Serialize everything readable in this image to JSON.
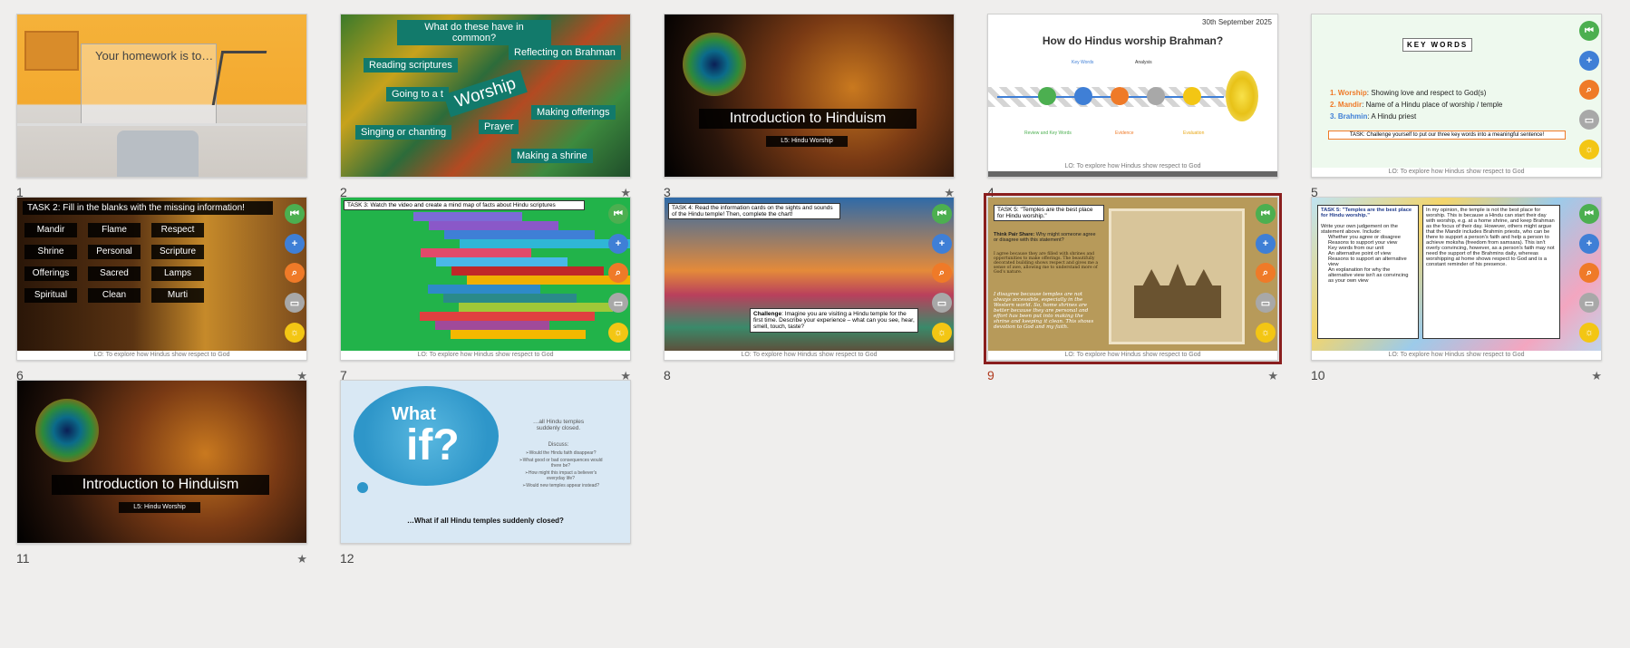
{
  "slides": [
    {
      "num": "1",
      "title": "Your homework is to…"
    },
    {
      "num": "2",
      "title": "What do these have in common?",
      "star": "★",
      "tags": [
        "Reflecting on Brahman",
        "Reading scriptures",
        "Going to a t",
        "Worship",
        "Making offerings",
        "Prayer",
        "Singing or chanting",
        "Making a shrine"
      ]
    },
    {
      "num": "3",
      "star": "★",
      "title": "Introduction to Hinduism",
      "subtitle": "L5: Hindu Worship"
    },
    {
      "num": "4",
      "date": "30th September 2025",
      "title": "How do Hindus worship Brahman?",
      "labels": [
        "Key Words",
        "Analysis",
        "Review and Key Words",
        "Evidence",
        "Evaluation"
      ],
      "lo": "LO: To explore how Hindus show respect to God"
    },
    {
      "num": "5",
      "keywords_title": "KEY WORDS",
      "items": [
        {
          "n": "1.",
          "term": "Worship",
          "def": ": Showing love and respect to God(s)"
        },
        {
          "n": "2.",
          "term": "Mandir",
          "def": ": Name of a Hindu place of worship / temple"
        },
        {
          "n": "3.",
          "term": "Brahmin",
          "def": ": A Hindu priest"
        }
      ],
      "task": "TASK: Challenge yourself to put our three key words into a meaningful sentence!",
      "lo": "LO: To explore how Hindus show respect to God"
    },
    {
      "num": "6",
      "star": "★",
      "title": "TASK 2: Fill in the blanks with the missing information!",
      "words": [
        "Mandir",
        "Flame",
        "Respect",
        "Shrine",
        "Personal",
        "Scripture",
        "Offerings",
        "Sacred",
        "Lamps",
        "Spiritual",
        "Clean",
        "Murti"
      ],
      "lo": "LO: To explore how Hindus show respect to God"
    },
    {
      "num": "7",
      "star": "★",
      "title": "TASK 3: Watch the video and create a mind map of facts about Hindu scriptures",
      "lo": "LO: To explore how Hindus show respect to God"
    },
    {
      "num": "8",
      "title": "TASK 4: Read the information cards on the sights and sounds of the Hindu temple! Then, complete the chart!",
      "challenge_label": "Challenge",
      "challenge": ": Imagine you are visiting a Hindu temple for the first time. Describe your experience – what can you see, hear, smell, touch, taste?",
      "lo": "LO: To explore how Hindus show respect to God"
    },
    {
      "num": "9",
      "star": "★",
      "title": "TASK 5: \"Temples are the best place for Hindu worship.\"",
      "think_label": "Think Pair Share:",
      "think": " Why might someone agree or disagree with this statement?",
      "para1": "I agree because they are filled with shrines and opportunities to make offerings. The beautifully decorated building shows respect and gives me a sense of awe, allowing me to understand more of God's nature.",
      "para2": "I disagree because temples are not always accessible, especially in the Western world. So, home shrines are better because they are personal and effort has been put into making the shrine and keeping it clean. This shows devotion to God and my faith.",
      "lo": "LO: To explore how Hindus show respect to God"
    },
    {
      "num": "10",
      "star": "★",
      "title": "TASK 5: \"Temples are the best place for Hindu worship.\"",
      "intro": "Write your own judgement on the statement above. Include:",
      "bullets": [
        "Whether you agree or disagree",
        "Reasons to support your view",
        "Key words from our unit",
        "An alternative point of view",
        "Reasons to support an alternative view",
        "An explanation for why the alternative view isn't as convincing as your own view"
      ],
      "answer": "In my opinion, the temple is not the best place for worship. This is because a Hindu can start their day with worship, e.g. at a home shrine, and keep Brahman as the focus of their day. However, others might argue that the Mandir includes Brahmin priests, who can be there to support a person's faith and help a person to achieve moksha (freedom from samsara). This isn't overly convincing, however, as a person's faith may not need the support of the Brahmins daily, whereas worshipping at home shows respect to God and is a constant reminder of his presence.",
      "lo": "LO: To explore how Hindus show respect to God"
    },
    {
      "num": "11",
      "star": "★",
      "title": "Introduction to Hinduism",
      "subtitle": "L5: Hindu Worship"
    },
    {
      "num": "12",
      "cloud_what": "What",
      "cloud_if": "if?",
      "line1": "…all Hindu temples suddenly closed.",
      "discuss": "Discuss:",
      "points": [
        "➢Would the Hindu faith disappear?",
        "➢What good or bad consequences would there be?",
        "➢How might this impact a believer's everyday life?",
        "➢Would new temples appear instead?"
      ],
      "footer": "…What if all Hindu temples suddenly closed?"
    }
  ],
  "colors": {
    "selected_border": "#8a1e1e",
    "nav_green": "#4caf50",
    "nav_blue": "#3f7fd6",
    "nav_orange": "#ef7a28",
    "nav_grey": "#a8a8a8",
    "nav_yellow": "#f3c614"
  }
}
